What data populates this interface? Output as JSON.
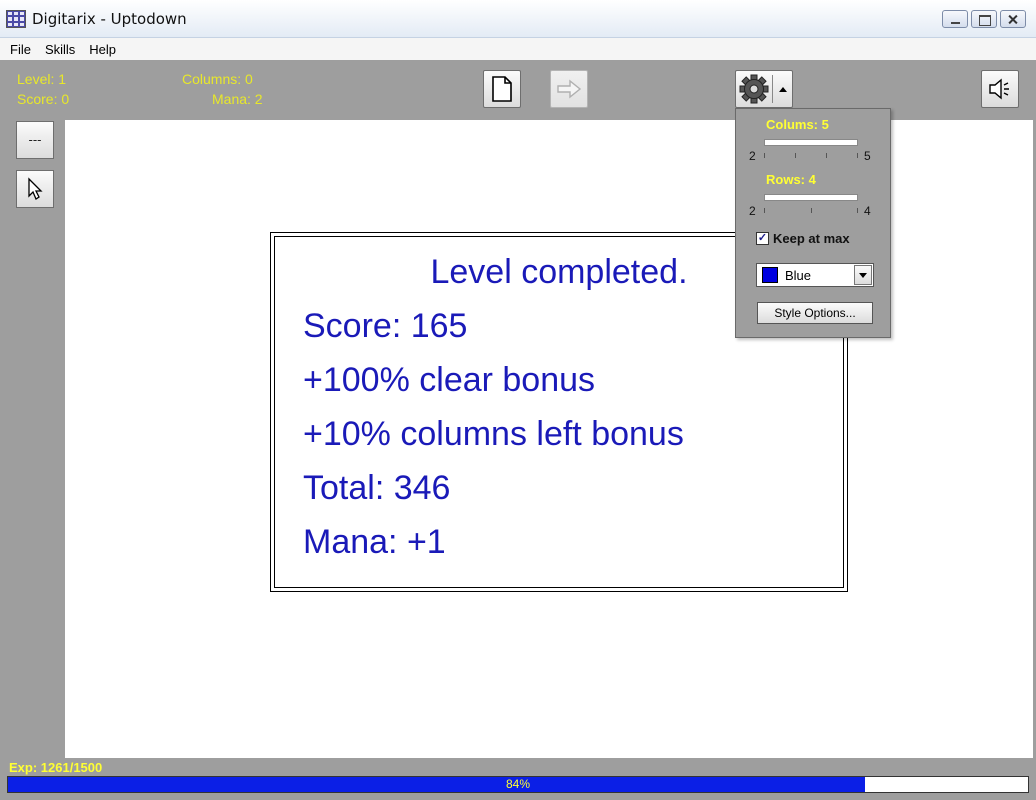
{
  "window": {
    "title": "Digitarix - Uptodown"
  },
  "menu": {
    "items": [
      "File",
      "Skills",
      "Help"
    ]
  },
  "stats": {
    "level": "Level: 1",
    "score": "Score: 0",
    "columns": "Columns: 0",
    "mana": "Mana: 2"
  },
  "side": {
    "more_label": "---"
  },
  "result": {
    "heading": "Level completed.",
    "score": "Score: 165",
    "clear_bonus": "+100% clear bonus",
    "columns_bonus": "+10% columns left bonus",
    "total": "Total: 346",
    "mana": "Mana: +1"
  },
  "settings": {
    "columns_label": "Colums: 5",
    "columns_min": "2",
    "columns_max": "5",
    "rows_label": "Rows: 4",
    "rows_min": "2",
    "rows_max": "4",
    "keep_at_max": "Keep at max",
    "keep_at_max_checked": true,
    "color_value": "Blue",
    "color_hex": "#0000e0",
    "style_options": "Style Options..."
  },
  "experience": {
    "label": "Exp: 1261/1500",
    "percent_text": "84%",
    "fraction": 0.84
  },
  "colors": {
    "accent": "#ffff33",
    "progress": "#0b1fe6",
    "result_text": "#1a1ab8"
  }
}
